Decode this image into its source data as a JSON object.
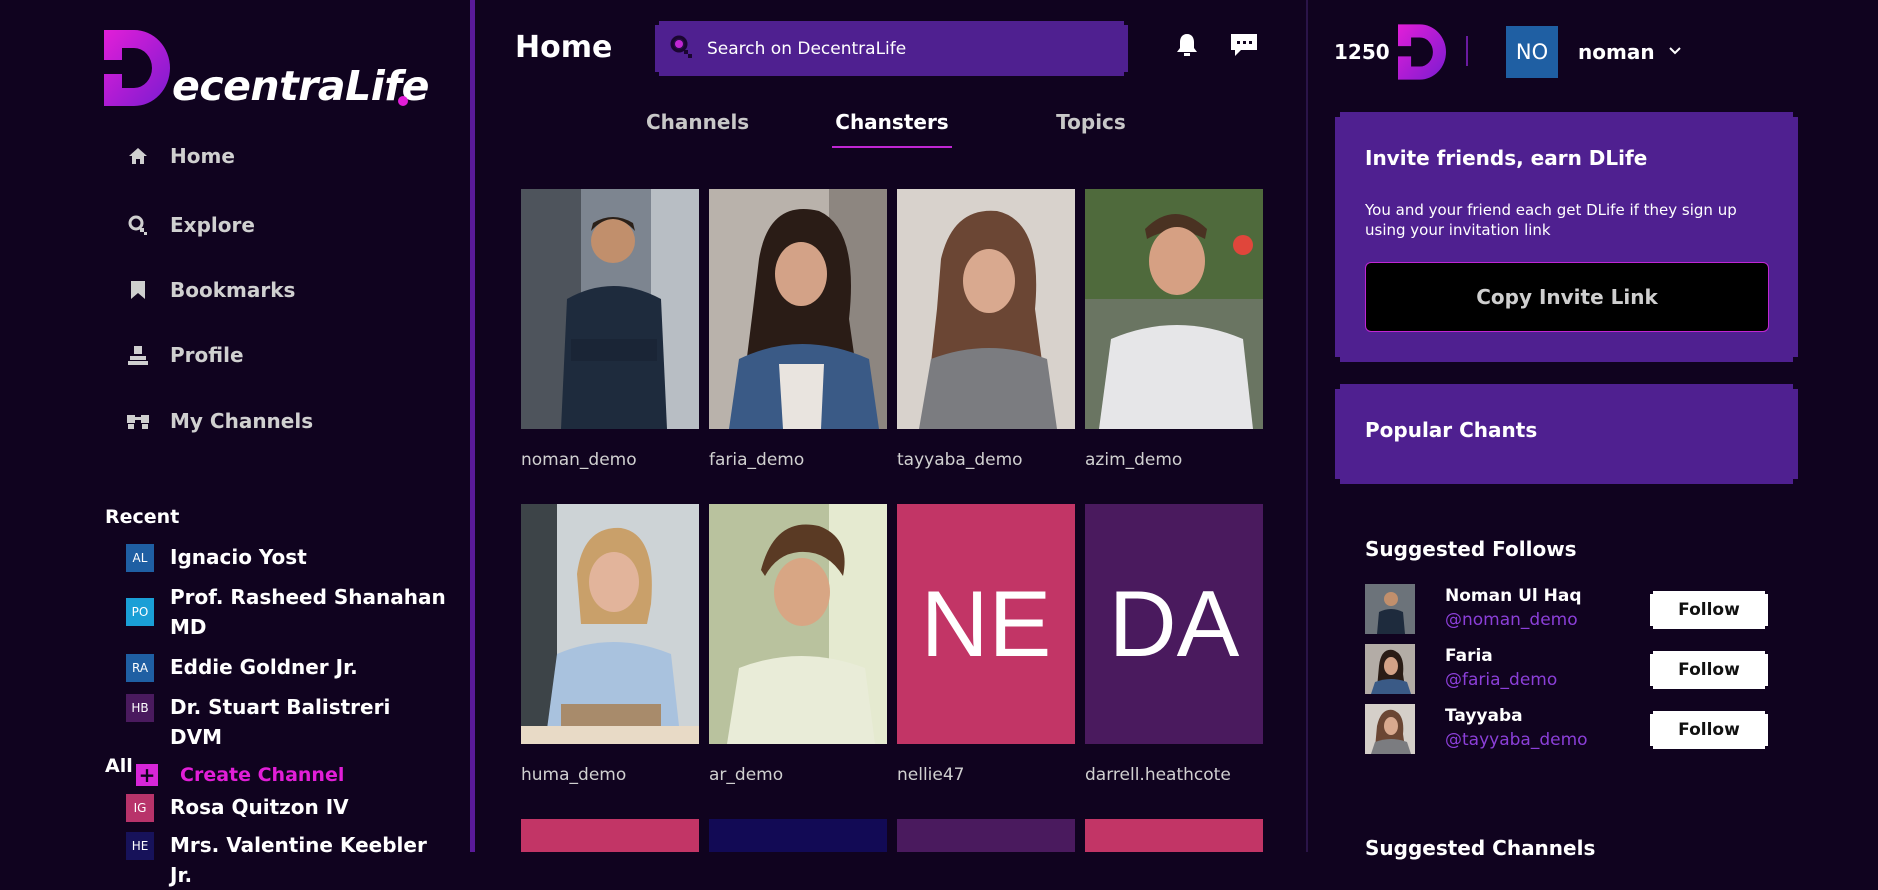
{
  "app": {
    "logo_text": "ecentraLife",
    "page_title": "Home"
  },
  "colors": {
    "background": "#10031f",
    "panel": "#4f2090",
    "accent": "#e21ed8",
    "link": "#8b3fd8"
  },
  "search": {
    "placeholder": "Search on DecentraLife",
    "icon": "search-icon"
  },
  "nav": [
    {
      "label": "Home",
      "icon": "home-icon"
    },
    {
      "label": "Explore",
      "icon": "explore-icon"
    },
    {
      "label": "Bookmarks",
      "icon": "bookmark-icon"
    },
    {
      "label": "Profile",
      "icon": "profile-icon"
    },
    {
      "label": "My Channels",
      "icon": "channels-icon"
    }
  ],
  "recent": {
    "title": "Recent",
    "items": [
      {
        "initials": "AL",
        "name": "Ignacio Yost",
        "color": "#1f5fa3"
      },
      {
        "initials": "PO",
        "name": "Prof. Rasheed Shanahan MD",
        "color": "#1a9fd6"
      },
      {
        "initials": "RA",
        "name": "Eddie Goldner Jr.",
        "color": "#1f5fa3"
      },
      {
        "initials": "HB",
        "name": "Dr. Stuart Balistreri DVM",
        "color": "#4a1a5e"
      }
    ]
  },
  "all": {
    "title": "All",
    "create_label": "Create Channel",
    "items": [
      {
        "initials": "IG",
        "name": "Rosa Quitzon IV",
        "color": "#b8336a"
      },
      {
        "initials": "HE",
        "name": "Mrs. Valentine Keebler Jr.",
        "color": "#17125a"
      }
    ]
  },
  "tabs": [
    {
      "label": "Channels",
      "active": false
    },
    {
      "label": "Chansters",
      "active": true
    },
    {
      "label": "Topics",
      "active": false
    }
  ],
  "chansters": [
    {
      "name": "noman_demo",
      "type": "photo"
    },
    {
      "name": "faria_demo",
      "type": "photo"
    },
    {
      "name": "tayyaba_demo",
      "type": "photo"
    },
    {
      "name": "azim_demo",
      "type": "photo"
    },
    {
      "name": "huma_demo",
      "type": "photo"
    },
    {
      "name": "ar_demo",
      "type": "photo"
    },
    {
      "name": "nellie47",
      "type": "initials",
      "initials": "NE",
      "color": "#c23566"
    },
    {
      "name": "darrell.heathcote",
      "type": "initials",
      "initials": "DA",
      "color": "#4a1a5e"
    }
  ],
  "next_row_colors": [
    "#c23566",
    "#120a55",
    "#4a1a5e",
    "#c23566"
  ],
  "header": {
    "balance": "1250",
    "user_initials": "NO",
    "username": "noman"
  },
  "invite": {
    "title": "Invite friends, earn DLife",
    "description": "You and your friend each get DLife if they sign up using your invitation link",
    "button_label": "Copy Invite Link"
  },
  "popular": {
    "title": "Popular Chants"
  },
  "suggested_follows": {
    "title": "Suggested Follows",
    "items": [
      {
        "name": "Noman Ul Haq",
        "handle": "@noman_demo",
        "button": "Follow"
      },
      {
        "name": "Faria",
        "handle": "@faria_demo",
        "button": "Follow"
      },
      {
        "name": "Tayyaba",
        "handle": "@tayyaba_demo",
        "button": "Follow"
      }
    ]
  },
  "suggested_channels": {
    "title": "Suggested Channels"
  }
}
